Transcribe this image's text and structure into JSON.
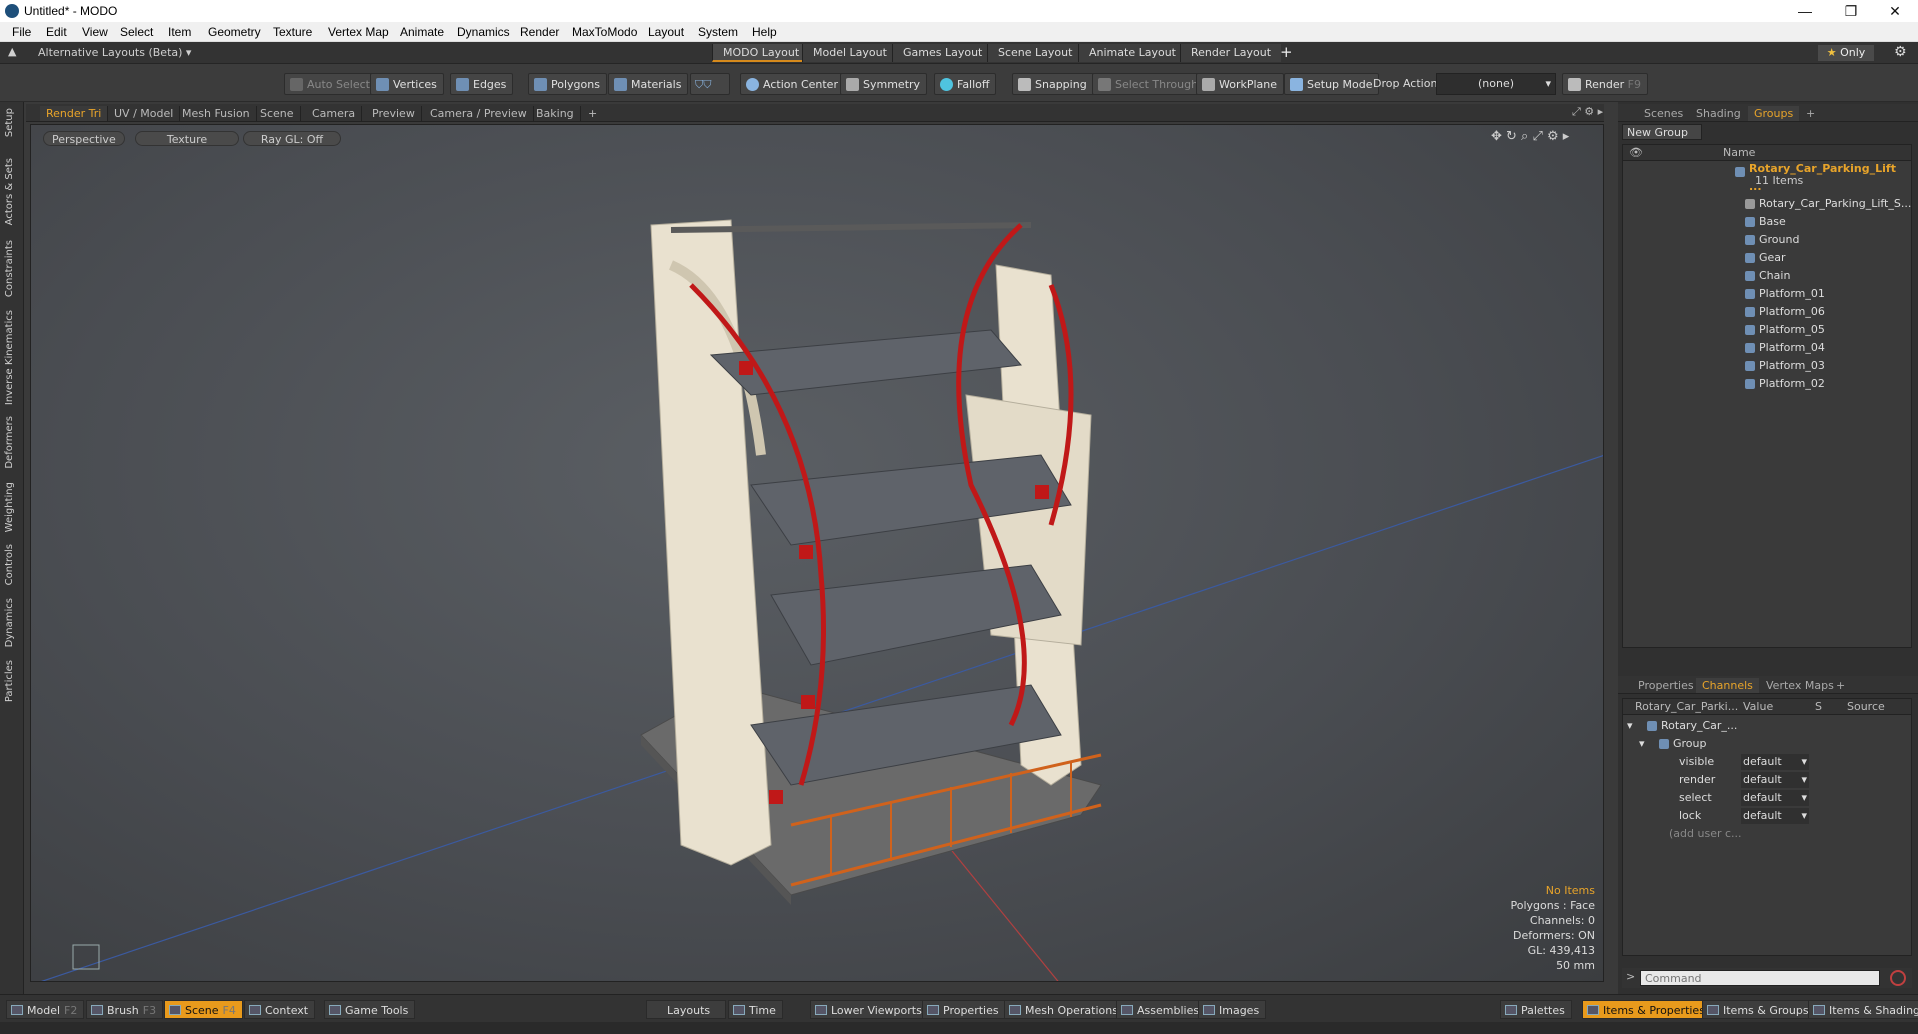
{
  "window": {
    "title": "Untitled* - MODO",
    "controls": [
      "—",
      "❐",
      "✕"
    ]
  },
  "menu": [
    "File",
    "Edit",
    "View",
    "Select",
    "Item",
    "Geometry",
    "Texture",
    "Vertex Map",
    "Animate",
    "Dynamics",
    "Render",
    "MaxToModo",
    "Layout",
    "System",
    "Help"
  ],
  "layout_bar": {
    "switcher": "Alternative Layouts (Beta)",
    "tabs": [
      "MODO Layout",
      "Model Layout",
      "Games Layout",
      "Scene Layout",
      "Animate Layout",
      "Render Layout"
    ],
    "add": "+",
    "only": "Only"
  },
  "toolbar": {
    "auto_select": "Auto Select",
    "vertices": "Vertices",
    "edges": "Edges",
    "polygons": "Polygons",
    "materials": "Materials",
    "action_center": "Action Center",
    "symmetry": "Symmetry",
    "falloff": "Falloff",
    "snapping": "Snapping",
    "select_through": "Select Through",
    "workplane": "WorkPlane",
    "setup_mode": "Setup Mode",
    "drop_action_label": "Drop Action",
    "drop_action_value": "(none)",
    "render": "Render",
    "render_key": "F9"
  },
  "left_tabs": [
    "Setup",
    "Actors & Sets",
    "Constraints",
    "Inverse Kinematics",
    "Deformers",
    "Weighting",
    "Controls",
    "Dynamics",
    "Particles"
  ],
  "viewport_tabs": [
    "Render Tri",
    "UV / Model",
    "Mesh Fusion",
    "Scene",
    "Camera",
    "Preview",
    "Camera / Preview",
    "Baking",
    "+"
  ],
  "viewport": {
    "chips": [
      "Perspective",
      "Texture",
      "Ray GL: Off"
    ],
    "info": {
      "selection": "No Items",
      "polygons": "Polygons : Face",
      "channels": "Channels: 0",
      "deformers": "Deformers: ON",
      "gl": "GL: 439,413",
      "scale": "50 mm"
    }
  },
  "groups_panel": {
    "tabs": [
      "Scenes",
      "Shading",
      "Groups",
      "+"
    ],
    "new_group": "New Group",
    "column_name": "Name",
    "root": {
      "label": "Rotary_Car_Parking_Lift ...",
      "count": "11 Items"
    },
    "items": [
      "Rotary_Car_Parking_Lift_S...",
      "Base",
      "Ground",
      "Gear",
      "Chain",
      "Platform_01",
      "Platform_06",
      "Platform_05",
      "Platform_04",
      "Platform_03",
      "Platform_02"
    ]
  },
  "channels_panel": {
    "tabs": [
      "Properties",
      "Channels",
      "Vertex Maps",
      "+"
    ],
    "columns": [
      "Rotary_Car_Parki...",
      "Value",
      "S",
      "Source"
    ],
    "tree_root": "Rotary_Car_...",
    "tree_group": "Group",
    "rows": [
      {
        "name": "visible",
        "value": "default"
      },
      {
        "name": "render",
        "value": "default"
      },
      {
        "name": "select",
        "value": "default"
      },
      {
        "name": "lock",
        "value": "default"
      }
    ],
    "add_user": "(add user c...",
    "command_placeholder": "Command"
  },
  "bottom_bar": {
    "left": [
      {
        "label": "Model",
        "key": "F2"
      },
      {
        "label": "Brush",
        "key": "F3"
      },
      {
        "label": "Scene",
        "key": "F4"
      },
      {
        "label": "Context",
        "key": ""
      },
      {
        "label": "Game Tools",
        "key": ""
      }
    ],
    "center": [
      "Layouts",
      "Time",
      "Lower Viewports",
      "Properties",
      "Mesh Operations",
      "Assemblies",
      "Images"
    ],
    "right": [
      "Palettes",
      "Items & Properties",
      "Items & Groups",
      "Items & Shading"
    ]
  },
  "colors": {
    "accent": "#e89a1c",
    "background": "#3a3a3a",
    "viewport": "#4f5257"
  }
}
